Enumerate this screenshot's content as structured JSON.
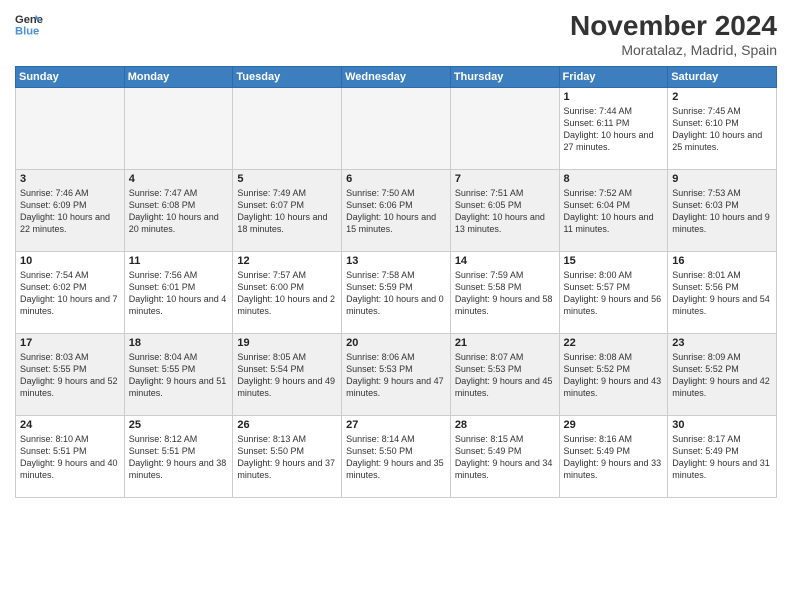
{
  "header": {
    "logo_line1": "General",
    "logo_line2": "Blue",
    "month": "November 2024",
    "location": "Moratalaz, Madrid, Spain"
  },
  "weekdays": [
    "Sunday",
    "Monday",
    "Tuesday",
    "Wednesday",
    "Thursday",
    "Friday",
    "Saturday"
  ],
  "weeks": [
    [
      {
        "day": "",
        "info": ""
      },
      {
        "day": "",
        "info": ""
      },
      {
        "day": "",
        "info": ""
      },
      {
        "day": "",
        "info": ""
      },
      {
        "day": "",
        "info": ""
      },
      {
        "day": "1",
        "info": "Sunrise: 7:44 AM\nSunset: 6:11 PM\nDaylight: 10 hours and 27 minutes."
      },
      {
        "day": "2",
        "info": "Sunrise: 7:45 AM\nSunset: 6:10 PM\nDaylight: 10 hours and 25 minutes."
      }
    ],
    [
      {
        "day": "3",
        "info": "Sunrise: 7:46 AM\nSunset: 6:09 PM\nDaylight: 10 hours and 22 minutes."
      },
      {
        "day": "4",
        "info": "Sunrise: 7:47 AM\nSunset: 6:08 PM\nDaylight: 10 hours and 20 minutes."
      },
      {
        "day": "5",
        "info": "Sunrise: 7:49 AM\nSunset: 6:07 PM\nDaylight: 10 hours and 18 minutes."
      },
      {
        "day": "6",
        "info": "Sunrise: 7:50 AM\nSunset: 6:06 PM\nDaylight: 10 hours and 15 minutes."
      },
      {
        "day": "7",
        "info": "Sunrise: 7:51 AM\nSunset: 6:05 PM\nDaylight: 10 hours and 13 minutes."
      },
      {
        "day": "8",
        "info": "Sunrise: 7:52 AM\nSunset: 6:04 PM\nDaylight: 10 hours and 11 minutes."
      },
      {
        "day": "9",
        "info": "Sunrise: 7:53 AM\nSunset: 6:03 PM\nDaylight: 10 hours and 9 minutes."
      }
    ],
    [
      {
        "day": "10",
        "info": "Sunrise: 7:54 AM\nSunset: 6:02 PM\nDaylight: 10 hours and 7 minutes."
      },
      {
        "day": "11",
        "info": "Sunrise: 7:56 AM\nSunset: 6:01 PM\nDaylight: 10 hours and 4 minutes."
      },
      {
        "day": "12",
        "info": "Sunrise: 7:57 AM\nSunset: 6:00 PM\nDaylight: 10 hours and 2 minutes."
      },
      {
        "day": "13",
        "info": "Sunrise: 7:58 AM\nSunset: 5:59 PM\nDaylight: 10 hours and 0 minutes."
      },
      {
        "day": "14",
        "info": "Sunrise: 7:59 AM\nSunset: 5:58 PM\nDaylight: 9 hours and 58 minutes."
      },
      {
        "day": "15",
        "info": "Sunrise: 8:00 AM\nSunset: 5:57 PM\nDaylight: 9 hours and 56 minutes."
      },
      {
        "day": "16",
        "info": "Sunrise: 8:01 AM\nSunset: 5:56 PM\nDaylight: 9 hours and 54 minutes."
      }
    ],
    [
      {
        "day": "17",
        "info": "Sunrise: 8:03 AM\nSunset: 5:55 PM\nDaylight: 9 hours and 52 minutes."
      },
      {
        "day": "18",
        "info": "Sunrise: 8:04 AM\nSunset: 5:55 PM\nDaylight: 9 hours and 51 minutes."
      },
      {
        "day": "19",
        "info": "Sunrise: 8:05 AM\nSunset: 5:54 PM\nDaylight: 9 hours and 49 minutes."
      },
      {
        "day": "20",
        "info": "Sunrise: 8:06 AM\nSunset: 5:53 PM\nDaylight: 9 hours and 47 minutes."
      },
      {
        "day": "21",
        "info": "Sunrise: 8:07 AM\nSunset: 5:53 PM\nDaylight: 9 hours and 45 minutes."
      },
      {
        "day": "22",
        "info": "Sunrise: 8:08 AM\nSunset: 5:52 PM\nDaylight: 9 hours and 43 minutes."
      },
      {
        "day": "23",
        "info": "Sunrise: 8:09 AM\nSunset: 5:52 PM\nDaylight: 9 hours and 42 minutes."
      }
    ],
    [
      {
        "day": "24",
        "info": "Sunrise: 8:10 AM\nSunset: 5:51 PM\nDaylight: 9 hours and 40 minutes."
      },
      {
        "day": "25",
        "info": "Sunrise: 8:12 AM\nSunset: 5:51 PM\nDaylight: 9 hours and 38 minutes."
      },
      {
        "day": "26",
        "info": "Sunrise: 8:13 AM\nSunset: 5:50 PM\nDaylight: 9 hours and 37 minutes."
      },
      {
        "day": "27",
        "info": "Sunrise: 8:14 AM\nSunset: 5:50 PM\nDaylight: 9 hours and 35 minutes."
      },
      {
        "day": "28",
        "info": "Sunrise: 8:15 AM\nSunset: 5:49 PM\nDaylight: 9 hours and 34 minutes."
      },
      {
        "day": "29",
        "info": "Sunrise: 8:16 AM\nSunset: 5:49 PM\nDaylight: 9 hours and 33 minutes."
      },
      {
        "day": "30",
        "info": "Sunrise: 8:17 AM\nSunset: 5:49 PM\nDaylight: 9 hours and 31 minutes."
      }
    ]
  ]
}
